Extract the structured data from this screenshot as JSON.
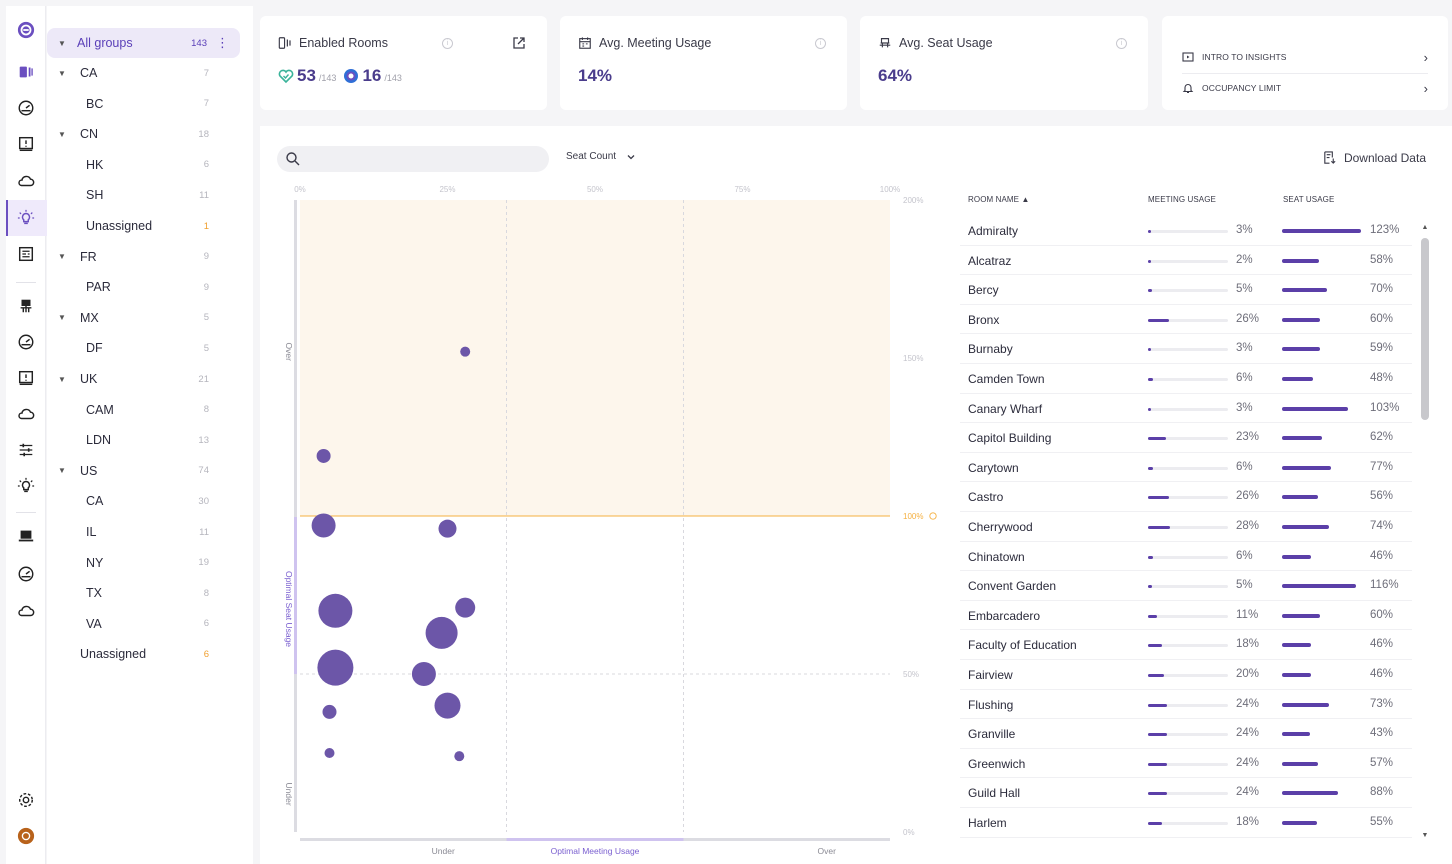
{
  "sidebar_groups": {
    "all": {
      "label": "All groups",
      "count": "143"
    },
    "rows": [
      {
        "label": "CA",
        "count": "7",
        "level": 1,
        "caret": true
      },
      {
        "label": "BC",
        "count": "7",
        "level": 2
      },
      {
        "label": "CN",
        "count": "18",
        "level": 1,
        "caret": true
      },
      {
        "label": "HK",
        "count": "6",
        "level": 2
      },
      {
        "label": "SH",
        "count": "11",
        "level": 2
      },
      {
        "label": "Unassigned",
        "count": "1",
        "level": 2,
        "orange": true
      },
      {
        "label": "FR",
        "count": "9",
        "level": 1,
        "caret": true
      },
      {
        "label": "PAR",
        "count": "9",
        "level": 2
      },
      {
        "label": "MX",
        "count": "5",
        "level": 1,
        "caret": true
      },
      {
        "label": "DF",
        "count": "5",
        "level": 2
      },
      {
        "label": "UK",
        "count": "21",
        "level": 1,
        "caret": true
      },
      {
        "label": "CAM",
        "count": "8",
        "level": 2
      },
      {
        "label": "LDN",
        "count": "13",
        "level": 2
      },
      {
        "label": "US",
        "count": "74",
        "level": 1,
        "caret": true
      },
      {
        "label": "CA",
        "count": "30",
        "level": 2
      },
      {
        "label": "IL",
        "count": "11",
        "level": 2
      },
      {
        "label": "NY",
        "count": "19",
        "level": 2
      },
      {
        "label": "TX",
        "count": "8",
        "level": 2
      },
      {
        "label": "VA",
        "count": "6",
        "level": 2
      },
      {
        "label": "Unassigned",
        "count": "6",
        "level": 1,
        "orange": true
      }
    ]
  },
  "cards": {
    "enabled": {
      "title": "Enabled Rooms",
      "online": "53",
      "online_total": "/143",
      "other": "16",
      "other_total": "/143"
    },
    "meeting": {
      "title": "Avg. Meeting Usage",
      "value": "14%"
    },
    "seat": {
      "title": "Avg. Seat Usage",
      "value": "64%"
    },
    "links": [
      {
        "label": "INTRO TO INSIGHTS"
      },
      {
        "label": "OCCUPANCY LIMIT"
      }
    ]
  },
  "toolbar": {
    "search_placeholder": "",
    "seat_count_label": "Seat Count",
    "download_label": "Download Data"
  },
  "chart_data": {
    "type": "scatter",
    "x_ticks": [
      "0%",
      "25%",
      "50%",
      "75%",
      "100%"
    ],
    "y_ticks": [
      "200%",
      "150%",
      "100%",
      "50%",
      "0%"
    ],
    "xlim": [
      0,
      100
    ],
    "ylim": [
      0,
      200
    ],
    "x_bands": [
      "Under",
      "Optimal Meeting Usage",
      "Over"
    ],
    "y_bands": [
      "Over",
      "Optimal Seat Usage",
      "Under"
    ],
    "threshold_label": "100%",
    "points": [
      {
        "x": 28,
        "y": 152,
        "r": 5
      },
      {
        "x": 4,
        "y": 119,
        "r": 7
      },
      {
        "x": 4,
        "y": 97,
        "r": 12
      },
      {
        "x": 25,
        "y": 96,
        "r": 9
      },
      {
        "x": 6,
        "y": 70,
        "r": 17
      },
      {
        "x": 28,
        "y": 71,
        "r": 10
      },
      {
        "x": 24,
        "y": 63,
        "r": 16
      },
      {
        "x": 6,
        "y": 52,
        "r": 18
      },
      {
        "x": 21,
        "y": 50,
        "r": 12
      },
      {
        "x": 25,
        "y": 40,
        "r": 13
      },
      {
        "x": 5,
        "y": 38,
        "r": 7
      },
      {
        "x": 5,
        "y": 25,
        "r": 5
      },
      {
        "x": 27,
        "y": 24,
        "r": 5
      }
    ]
  },
  "table": {
    "headers": {
      "name": "ROOM NAME",
      "meeting": "MEETING USAGE",
      "seat": "SEAT USAGE"
    },
    "rows": [
      {
        "name": "Admiralty",
        "meeting": "3%",
        "m": 3,
        "seat": "123%",
        "s": 123
      },
      {
        "name": "Alcatraz",
        "meeting": "2%",
        "m": 2,
        "seat": "58%",
        "s": 58
      },
      {
        "name": "Bercy",
        "meeting": "5%",
        "m": 5,
        "seat": "70%",
        "s": 70
      },
      {
        "name": "Bronx",
        "meeting": "26%",
        "m": 26,
        "seat": "60%",
        "s": 60
      },
      {
        "name": "Burnaby",
        "meeting": "3%",
        "m": 3,
        "seat": "59%",
        "s": 59
      },
      {
        "name": "Camden Town",
        "meeting": "6%",
        "m": 6,
        "seat": "48%",
        "s": 48
      },
      {
        "name": "Canary Wharf",
        "meeting": "3%",
        "m": 3,
        "seat": "103%",
        "s": 103
      },
      {
        "name": "Capitol Building",
        "meeting": "23%",
        "m": 23,
        "seat": "62%",
        "s": 62
      },
      {
        "name": "Carytown",
        "meeting": "6%",
        "m": 6,
        "seat": "77%",
        "s": 77
      },
      {
        "name": "Castro",
        "meeting": "26%",
        "m": 26,
        "seat": "56%",
        "s": 56
      },
      {
        "name": "Cherrywood",
        "meeting": "28%",
        "m": 28,
        "seat": "74%",
        "s": 74
      },
      {
        "name": "Chinatown",
        "meeting": "6%",
        "m": 6,
        "seat": "46%",
        "s": 46
      },
      {
        "name": "Convent Garden",
        "meeting": "5%",
        "m": 5,
        "seat": "116%",
        "s": 116
      },
      {
        "name": "Embarcadero",
        "meeting": "11%",
        "m": 11,
        "seat": "60%",
        "s": 60
      },
      {
        "name": "Faculty of Education",
        "meeting": "18%",
        "m": 18,
        "seat": "46%",
        "s": 46
      },
      {
        "name": "Fairview",
        "meeting": "20%",
        "m": 20,
        "seat": "46%",
        "s": 46
      },
      {
        "name": "Flushing",
        "meeting": "24%",
        "m": 24,
        "seat": "73%",
        "s": 73
      },
      {
        "name": "Granville",
        "meeting": "24%",
        "m": 24,
        "seat": "43%",
        "s": 43
      },
      {
        "name": "Greenwich",
        "meeting": "24%",
        "m": 24,
        "seat": "57%",
        "s": 57
      },
      {
        "name": "Guild Hall",
        "meeting": "24%",
        "m": 24,
        "seat": "88%",
        "s": 88
      },
      {
        "name": "Harlem",
        "meeting": "18%",
        "m": 18,
        "seat": "55%",
        "s": 55
      }
    ]
  },
  "colors": {
    "accent": "#6b4fc0",
    "bubble": "#6c56a8",
    "bar": "#5b3fa8",
    "threshold": "#f5b040",
    "over_zone": "#fdf6ec",
    "green": "#3ab39a"
  }
}
